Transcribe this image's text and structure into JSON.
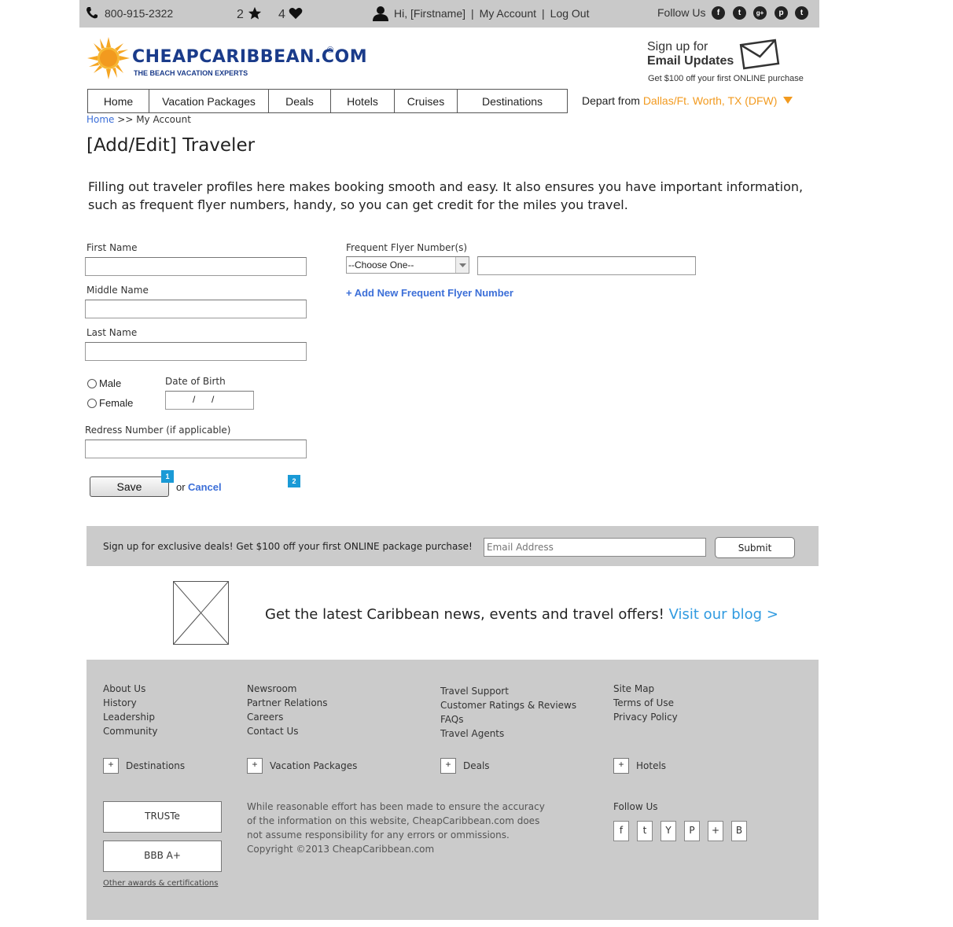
{
  "topbar": {
    "phone": "800-915-2322",
    "favorites_count": "2",
    "likes_count": "4",
    "greeting": "Hi, [Firstname]",
    "my_account": "My Account",
    "log_out": "Log Out",
    "follow_us": "Follow Us",
    "social": [
      "f",
      "t",
      "g+",
      "p",
      "t"
    ]
  },
  "logo": {
    "brand": "CHEAPCARIBBEAN.COM",
    "registered": "®",
    "tagline": "THE BEACH VACATION EXPERTS"
  },
  "signup_promo": {
    "line1": "Sign up for",
    "line2": "Email Updates",
    "subtext": "Get $100 off your first ONLINE purchase"
  },
  "nav": {
    "items": [
      "Home",
      "Vacation Packages",
      "Deals",
      "Hotels",
      "Cruises",
      "Destinations"
    ],
    "depart_label": "Depart from",
    "depart_value": "Dallas/Ft. Worth, TX (DFW)"
  },
  "breadcrumb": {
    "home": "Home",
    "sep": ">>",
    "current": "My Account"
  },
  "page": {
    "title": "[Add/Edit] Traveler",
    "intro": "Filling out traveler profiles here makes booking smooth and easy. It also ensures you have important information, such as frequent flyer numbers, handy, so you can get credit for the miles you travel."
  },
  "form": {
    "first_name_label": "First Name",
    "first_name_value": "",
    "middle_name_label": "Middle Name",
    "middle_name_value": "",
    "last_name_label": "Last Name",
    "last_name_value": "",
    "gender_male": "Male",
    "gender_female": "Female",
    "dob_label": "Date of Birth",
    "dob_sep": "/",
    "redress_label": "Redress Number (if applicable)",
    "redress_value": "",
    "ff_label": "Frequent Flyer Number(s)",
    "ff_select": "--Choose One--",
    "ff_number_value": "",
    "ff_add": "+ Add New Frequent Flyer Number",
    "save": "Save",
    "or": "or",
    "cancel": "Cancel",
    "marker1": "1",
    "marker2": "2"
  },
  "newsletter": {
    "text": "Sign up for exclusive deals! Get $100 off your first ONLINE package purchase!",
    "email_placeholder": "Email Address",
    "submit": "Submit"
  },
  "blog": {
    "text": "Get the latest Caribbean news, events and travel offers!",
    "link": "Visit our blog >"
  },
  "footer": {
    "col1": [
      "About Us",
      "History",
      "Leadership",
      "Community"
    ],
    "col2": [
      "Newsroom",
      "Partner Relations",
      "Careers",
      "Contact Us"
    ],
    "col3": [
      "Travel Support",
      "Customer Ratings & Reviews",
      "FAQs",
      "Travel Agents"
    ],
    "col4": [
      "Site Map",
      "Terms of Use",
      "Privacy Policy"
    ],
    "expanders": [
      "Destinations",
      "Vacation Packages",
      "Deals",
      "Hotels"
    ],
    "expander_symbol": "+",
    "badges": [
      "TRUSTe",
      "BBB A+"
    ],
    "awards_link": "Other awards & certifications",
    "disclaimer": "While reasonable effort has been made to ensure the accuracy of the information on this website, CheapCaribbean.com does not assume responsibility for any errors or ommissions.",
    "copyright": "Copyright ©2013 CheapCaribbean.com",
    "follow_us": "Follow Us",
    "social": [
      "f",
      "t",
      "Y",
      "P",
      "+",
      "B"
    ]
  },
  "colors": {
    "accent_orange": "#f29a1f",
    "link_blue": "#3c6fd8",
    "brand_blue": "#1a3b8a",
    "marker_blue": "#1a9ad6"
  }
}
